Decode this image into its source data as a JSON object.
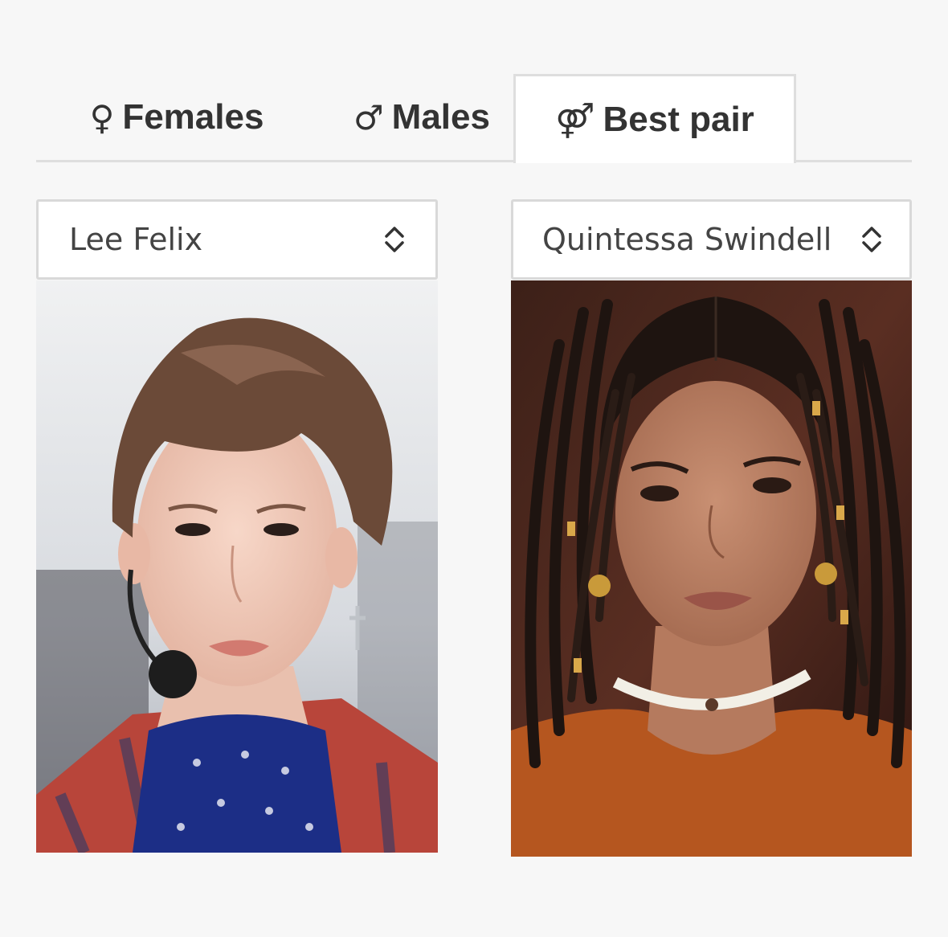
{
  "tabs": {
    "females": {
      "symbol": "♀",
      "label": "Females"
    },
    "males": {
      "symbol": "♂",
      "label": "Males"
    },
    "best_pair": {
      "symbol": "⚤",
      "label": "Best pair",
      "active": true
    }
  },
  "selectors": {
    "left": {
      "value": "Lee Felix",
      "icon": "updown-chevron-icon"
    },
    "right": {
      "value": "Quintessa Swindell",
      "icon": "updown-chevron-icon"
    }
  },
  "photos": {
    "left": {
      "icon": "person-photo"
    },
    "right": {
      "icon": "person-photo"
    }
  },
  "colors": {
    "background": "#f7f7f7",
    "active_tab": "#ffffff",
    "border": "#dedede",
    "text": "#333333"
  }
}
